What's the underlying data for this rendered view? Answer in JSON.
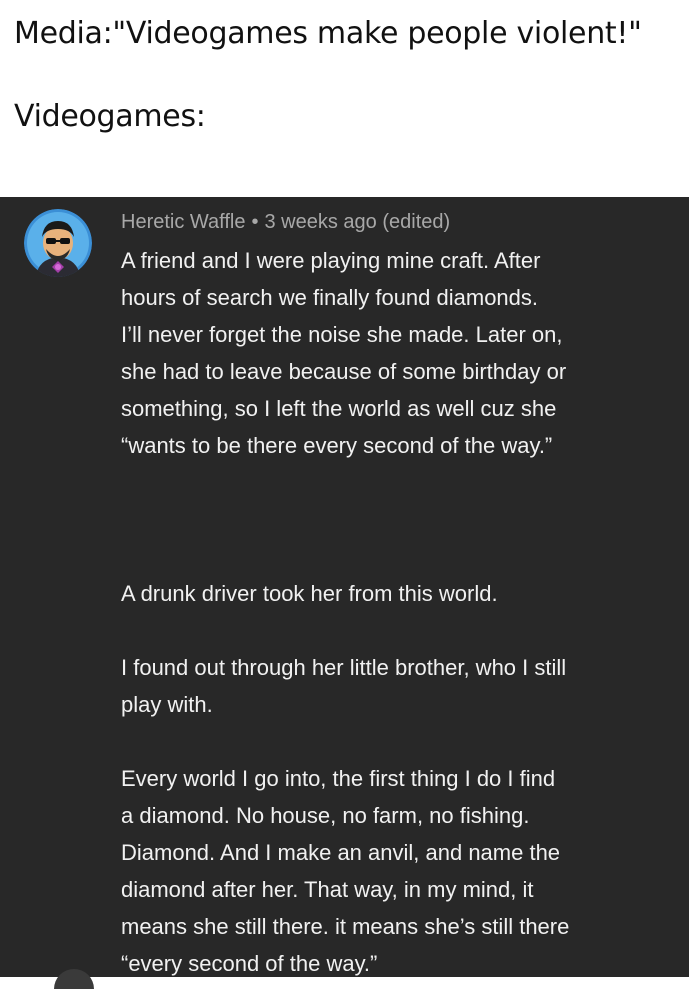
{
  "meme": {
    "line1": "Media:\"Videogames make  people violent!\"",
    "line2": "Videogames:"
  },
  "comment": {
    "author": "Heretic Waffle",
    "separator": "•",
    "time": "3 weeks ago (edited)",
    "avatar_icon": "cartoon-face-avatar",
    "paragraphs": [
      {
        "lines": [
          "A friend and I were playing mine craft. After",
          "hours of search we finally found diamonds.",
          "I’ll never forget the noise she made. Later on,",
          "she had to leave because of some birthday or",
          "something, so I left the world as well cuz she",
          "“wants to be there every second of the way.”"
        ]
      },
      {
        "lines": [
          "A drunk driver took her from this world."
        ]
      },
      {
        "lines": [
          "I found out through her little brother, who I still",
          "play with."
        ]
      },
      {
        "lines": [
          "Every world I go into, the first thing I do I find",
          "a diamond. No house, no farm, no fishing.",
          "Diamond. And I make an anvil, and name the",
          "diamond after her. That way, in my mind, it",
          "means she still there. it means she’s still there",
          "“every second of the way.”"
        ]
      }
    ]
  },
  "colors": {
    "panel_bg": "#282828",
    "meta_text": "#a8a8a8",
    "body_text": "#f1f1f1",
    "header_text": "#111111"
  }
}
